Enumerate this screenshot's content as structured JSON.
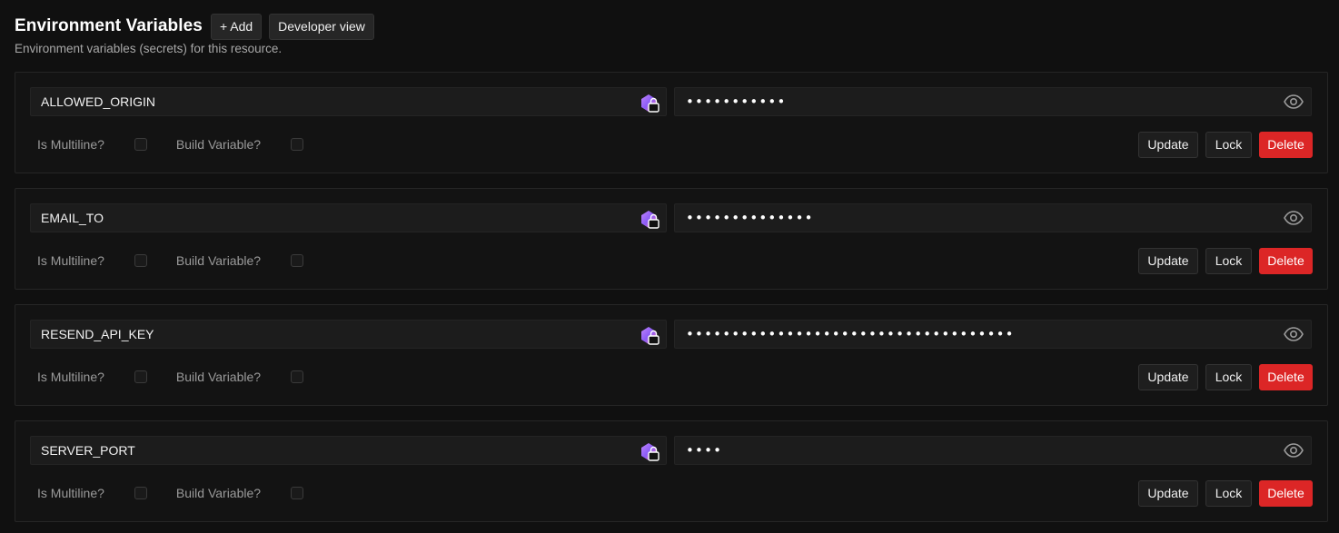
{
  "header": {
    "title": "Environment Variables",
    "add_label": "+ Add",
    "developer_view_label": "Developer view",
    "subtitle": "Environment variables (secrets) for this resource."
  },
  "labels": {
    "multiline": "Is Multiline?",
    "build_variable": "Build Variable?",
    "update": "Update",
    "lock": "Lock",
    "delete": "Delete"
  },
  "variables": [
    {
      "key": "ALLOWED_ORIGIN",
      "masked_value": "•••••••••••",
      "is_multiline": false,
      "is_build_variable": false
    },
    {
      "key": "EMAIL_TO",
      "masked_value": "••••••••••••••",
      "is_multiline": false,
      "is_build_variable": false
    },
    {
      "key": "RESEND_API_KEY",
      "masked_value": "••••••••••••••••••••••••••••••••••••",
      "is_multiline": false,
      "is_build_variable": false
    },
    {
      "key": "SERVER_PORT",
      "masked_value": "••••",
      "is_multiline": false,
      "is_build_variable": false
    }
  ],
  "colors": {
    "background": "#101010",
    "card_border": "#262626",
    "delete": "#dc2626"
  },
  "icons": {
    "key_badge": "lock-badge-icon",
    "value_toggle": "eye-icon"
  }
}
